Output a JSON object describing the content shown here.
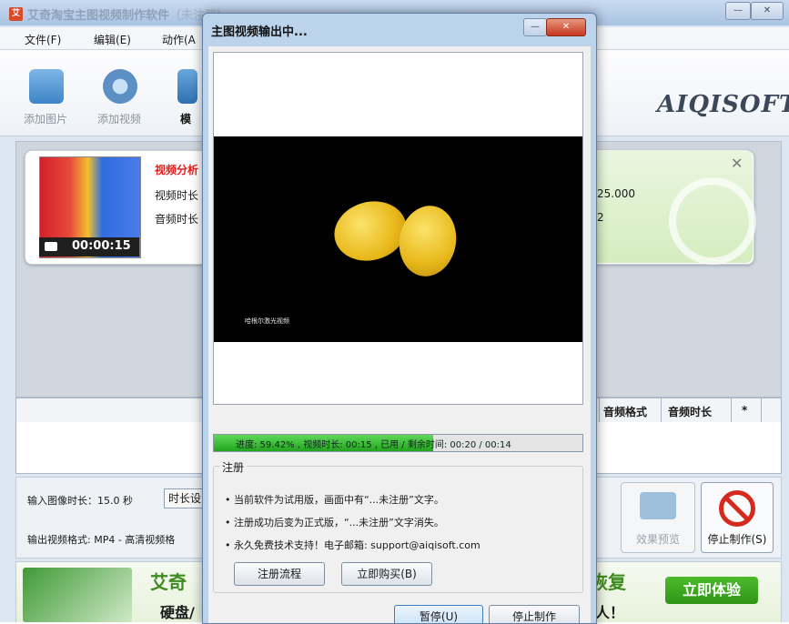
{
  "main_window": {
    "title": "艾奇淘宝主图视频制作软件",
    "title_suffix": "（未注册）",
    "controls": {
      "minimize": "—",
      "close": "✕"
    }
  },
  "menubar": {
    "items": [
      "文件(F)",
      "编辑(E)",
      "动作(A"
    ]
  },
  "toolbar": {
    "add_image": "添加图片",
    "add_video": "添加视频",
    "template": "模",
    "brand": "AIQISOFT"
  },
  "video_card": {
    "title": "视频分析",
    "video_duration_label": "视频时长",
    "audio_duration_label": "音频时长",
    "video_value": "25.000",
    "audio_value": "2",
    "thumb_time": "00:00:15",
    "close": "✕"
  },
  "table": {
    "columns": [
      "音频格式",
      "音频时长",
      "*"
    ]
  },
  "settings": {
    "image_duration": "输入图像时长：15.0 秒",
    "duration_button": "时长设",
    "output_format": "输出视频格式: MP4 - 高清视频格",
    "preview_label": "效果预览",
    "stop_label": "停止制作(S)"
  },
  "ad": {
    "title_left": "艾奇",
    "sub_left": "硬盘/",
    "title_right": "恢复",
    "sub_right": "人！",
    "cta": "立即体验"
  },
  "dialog": {
    "title": "主图视频输出中...",
    "min": "—",
    "close": "✕",
    "video_caption": "哈根尔激光视频",
    "progress_text": "进度: 59.42% , 视频时长: 00:15 , 已用 / 剩余时间: 00:20 / 00:14",
    "progress_percent": 59.42,
    "reg_legend": "注册",
    "reg_lines": [
      "• 当前软件为试用版，画面中有“...未注册”文字。",
      "• 注册成功后变为正式版，“...未注册”文字消失。",
      "• 永久免费技术支持！电子邮箱:   support@aiqisoft.com"
    ],
    "reg_flow_btn": "注册流程",
    "buy_btn": "立即购买(B)",
    "pause_btn": "暂停(U)",
    "stop_btn": "停止制作"
  }
}
